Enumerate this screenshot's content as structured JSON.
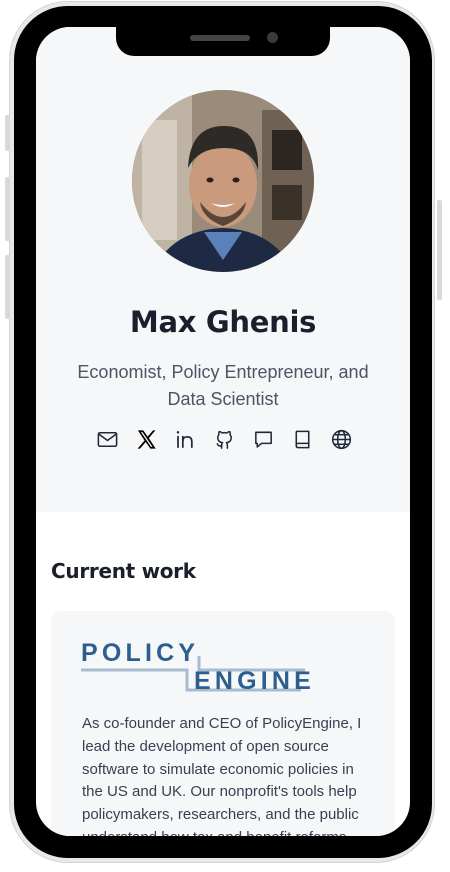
{
  "profile": {
    "name": "Max Ghenis",
    "tagline": "Economist, Policy Entrepreneur, and Data Scientist",
    "avatar_alt": "Max Ghenis portrait"
  },
  "socials": [
    {
      "name": "email-icon",
      "label": "Email"
    },
    {
      "name": "x-icon",
      "label": "X"
    },
    {
      "name": "linkedin-icon",
      "label": "LinkedIn"
    },
    {
      "name": "github-icon",
      "label": "GitHub"
    },
    {
      "name": "chat-icon",
      "label": "Chat"
    },
    {
      "name": "book-icon",
      "label": "Book"
    },
    {
      "name": "globe-icon",
      "label": "Website"
    }
  ],
  "current_work": {
    "title": "Current work",
    "logo_top": "POLICY",
    "logo_bottom": "ENGINE",
    "description": "As co-founder and CEO of PolicyEngine, I lead the development of open source software to simulate economic policies in the US and UK. Our nonprofit's tools help policymakers, researchers, and the public understand how tax and benefit reforms"
  },
  "colors": {
    "brand_blue": "#2c5f8f",
    "logo_line": "#a9bccf",
    "text_dark": "#1a1f2b",
    "hero_bg": "#f6f7f9"
  }
}
